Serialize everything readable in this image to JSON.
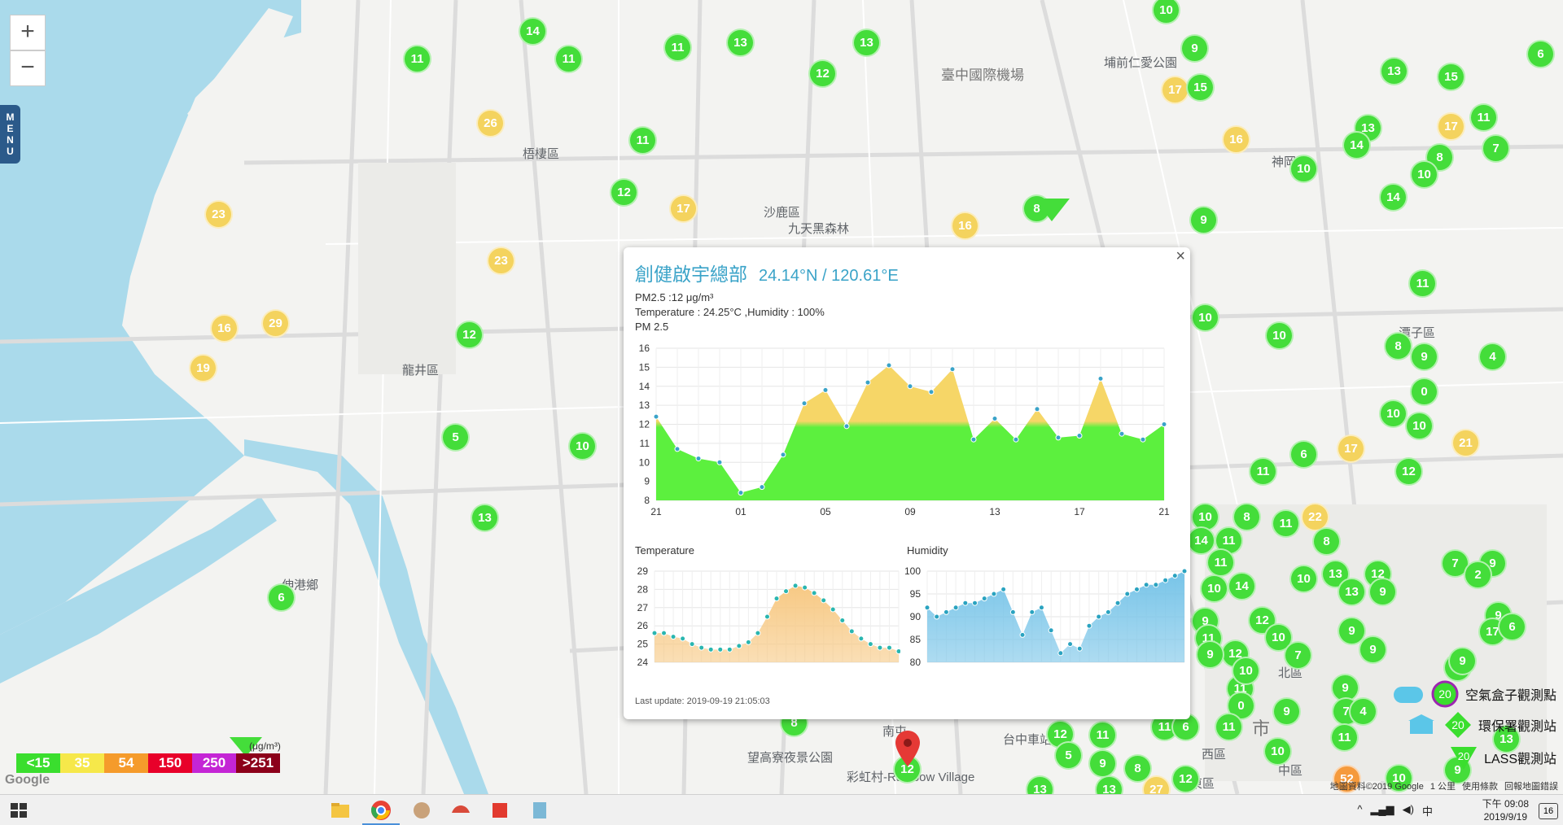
{
  "map": {
    "zoom_in": "+",
    "zoom_out": "−",
    "menu": [
      "M",
      "E",
      "N",
      "U"
    ],
    "labels": {
      "airport": "臺中國際機場",
      "wuqi": "梧棲區",
      "shalu": "沙鹿區",
      "longjing": "龍井區",
      "shengang": "神岡區",
      "tanzi": "潭子區",
      "jiatian": "九天黑森林",
      "park": "埔前仁愛公園",
      "wangao": "望高寮夜景公園",
      "rainbow": "彩虹村-Rainbow Village",
      "north": "北區",
      "west": "西區",
      "east": "東區",
      "central": "中區",
      "city": "市",
      "nanton": "南屯",
      "shengang_x": "伸港鄉",
      "taichung_rw": "台中車站"
    },
    "markers": [
      {
        "n": "10",
        "c": "g",
        "x": 1432,
        "y": 12
      },
      {
        "n": "14",
        "c": "g",
        "x": 654,
        "y": 38
      },
      {
        "n": "11",
        "c": "g",
        "x": 512,
        "y": 72
      },
      {
        "n": "11",
        "c": "g",
        "x": 698,
        "y": 72
      },
      {
        "n": "11",
        "c": "g",
        "x": 832,
        "y": 58
      },
      {
        "n": "13",
        "c": "g",
        "x": 909,
        "y": 52
      },
      {
        "n": "13",
        "c": "g",
        "x": 1064,
        "y": 52
      },
      {
        "n": "12",
        "c": "g",
        "x": 1010,
        "y": 90
      },
      {
        "n": "9",
        "c": "g",
        "x": 1467,
        "y": 59
      },
      {
        "n": "17",
        "c": "y",
        "x": 1443,
        "y": 110
      },
      {
        "n": "15",
        "c": "g",
        "x": 1474,
        "y": 107
      },
      {
        "n": "13",
        "c": "g",
        "x": 1712,
        "y": 87
      },
      {
        "n": "15",
        "c": "g",
        "x": 1782,
        "y": 94
      },
      {
        "n": "6",
        "c": "g",
        "x": 1892,
        "y": 66
      },
      {
        "n": "26",
        "c": "y",
        "x": 602,
        "y": 151
      },
      {
        "n": "11",
        "c": "g",
        "x": 789,
        "y": 172
      },
      {
        "n": "16",
        "c": "y",
        "x": 1518,
        "y": 171
      },
      {
        "n": "13",
        "c": "g",
        "x": 1680,
        "y": 157
      },
      {
        "n": "14",
        "c": "g",
        "x": 1666,
        "y": 178
      },
      {
        "n": "17",
        "c": "y",
        "x": 1782,
        "y": 155
      },
      {
        "n": "11",
        "c": "g",
        "x": 1822,
        "y": 144
      },
      {
        "n": "7",
        "c": "g",
        "x": 1837,
        "y": 182
      },
      {
        "n": "8",
        "c": "g",
        "x": 1768,
        "y": 193
      },
      {
        "n": "10",
        "c": "g",
        "x": 1601,
        "y": 207
      },
      {
        "n": "10",
        "c": "g",
        "x": 1749,
        "y": 214
      },
      {
        "n": "12",
        "c": "g",
        "x": 766,
        "y": 236
      },
      {
        "n": "17",
        "c": "y",
        "x": 839,
        "y": 256
      },
      {
        "n": "8",
        "c": "g",
        "x": 1273,
        "y": 256
      },
      {
        "n": "9",
        "c": "g",
        "x": 1478,
        "y": 270
      },
      {
        "n": "14",
        "c": "g",
        "x": 1711,
        "y": 242
      },
      {
        "n": "23",
        "c": "y",
        "x": 268,
        "y": 263
      },
      {
        "n": "16",
        "c": "y",
        "x": 1185,
        "y": 277
      },
      {
        "n": "23",
        "c": "y",
        "x": 615,
        "y": 320
      },
      {
        "n": "29",
        "c": "y",
        "x": 338,
        "y": 397
      },
      {
        "n": "16",
        "c": "y",
        "x": 275,
        "y": 403
      },
      {
        "n": "19",
        "c": "y",
        "x": 249,
        "y": 452
      },
      {
        "n": "12",
        "c": "g",
        "x": 576,
        "y": 411
      },
      {
        "n": "5",
        "c": "g",
        "x": 559,
        "y": 537
      },
      {
        "n": "10",
        "c": "g",
        "x": 715,
        "y": 548
      },
      {
        "n": "13",
        "c": "g",
        "x": 595,
        "y": 636
      },
      {
        "n": "6",
        "c": "g",
        "x": 345,
        "y": 734
      },
      {
        "n": "10",
        "c": "g",
        "x": 1480,
        "y": 390
      },
      {
        "n": "10",
        "c": "g",
        "x": 1571,
        "y": 412
      },
      {
        "n": "11",
        "c": "g",
        "x": 1747,
        "y": 348
      },
      {
        "n": "8",
        "c": "g",
        "x": 1717,
        "y": 425
      },
      {
        "n": "9",
        "c": "g",
        "x": 1749,
        "y": 438
      },
      {
        "n": "4",
        "c": "g",
        "x": 1833,
        "y": 438
      },
      {
        "n": "0",
        "c": "g",
        "x": 1749,
        "y": 481
      },
      {
        "n": "10",
        "c": "g",
        "x": 1711,
        "y": 508
      },
      {
        "n": "10",
        "c": "g",
        "x": 1743,
        "y": 523
      },
      {
        "n": "21",
        "c": "y",
        "x": 1800,
        "y": 544
      },
      {
        "n": "17",
        "c": "y",
        "x": 1659,
        "y": 551
      },
      {
        "n": "6",
        "c": "g",
        "x": 1601,
        "y": 558
      },
      {
        "n": "11",
        "c": "g",
        "x": 1551,
        "y": 579
      },
      {
        "n": "12",
        "c": "g",
        "x": 1730,
        "y": 579
      },
      {
        "n": "22",
        "c": "y",
        "x": 1615,
        "y": 635
      },
      {
        "n": "10",
        "c": "g",
        "x": 1480,
        "y": 635
      },
      {
        "n": "8",
        "c": "g",
        "x": 1531,
        "y": 635
      },
      {
        "n": "11",
        "c": "g",
        "x": 1579,
        "y": 643
      },
      {
        "n": "8",
        "c": "g",
        "x": 1629,
        "y": 665
      },
      {
        "n": "14",
        "c": "g",
        "x": 1475,
        "y": 664
      },
      {
        "n": "11",
        "c": "g",
        "x": 1509,
        "y": 664
      },
      {
        "n": "11",
        "c": "g",
        "x": 1499,
        "y": 691
      },
      {
        "n": "10",
        "c": "g",
        "x": 1601,
        "y": 711
      },
      {
        "n": "13",
        "c": "g",
        "x": 1640,
        "y": 705
      },
      {
        "n": "12",
        "c": "g",
        "x": 1692,
        "y": 705
      },
      {
        "n": "13",
        "c": "g",
        "x": 1660,
        "y": 727
      },
      {
        "n": "9",
        "c": "g",
        "x": 1698,
        "y": 727
      },
      {
        "n": "10",
        "c": "g",
        "x": 1491,
        "y": 723
      },
      {
        "n": "14",
        "c": "g",
        "x": 1525,
        "y": 720
      },
      {
        "n": "7",
        "c": "g",
        "x": 1787,
        "y": 692
      },
      {
        "n": "9",
        "c": "g",
        "x": 1833,
        "y": 692
      },
      {
        "n": "2",
        "c": "g",
        "x": 1815,
        "y": 706
      },
      {
        "n": "9",
        "c": "g",
        "x": 1840,
        "y": 756
      },
      {
        "n": "17",
        "c": "g",
        "x": 1833,
        "y": 776
      },
      {
        "n": "6",
        "c": "g",
        "x": 1857,
        "y": 770
      },
      {
        "n": "9",
        "c": "g",
        "x": 1480,
        "y": 763
      },
      {
        "n": "11",
        "c": "g",
        "x": 1484,
        "y": 784
      },
      {
        "n": "12",
        "c": "g",
        "x": 1550,
        "y": 762
      },
      {
        "n": "10",
        "c": "g",
        "x": 1570,
        "y": 783
      },
      {
        "n": "9",
        "c": "g",
        "x": 1660,
        "y": 775
      },
      {
        "n": "9",
        "c": "g",
        "x": 1686,
        "y": 798
      },
      {
        "n": "12",
        "c": "g",
        "x": 1517,
        "y": 803
      },
      {
        "n": "9",
        "c": "g",
        "x": 1486,
        "y": 804
      },
      {
        "n": "7",
        "c": "g",
        "x": 1594,
        "y": 805
      },
      {
        "n": "11",
        "c": "g",
        "x": 1523,
        "y": 846
      },
      {
        "n": "10",
        "c": "g",
        "x": 1530,
        "y": 824
      },
      {
        "n": "11",
        "c": "g",
        "x": 1422,
        "y": 811
      },
      {
        "n": "8",
        "c": "g",
        "x": 1790,
        "y": 820
      },
      {
        "n": "9",
        "c": "g",
        "x": 1796,
        "y": 812
      },
      {
        "n": "9",
        "c": "g",
        "x": 1652,
        "y": 845
      },
      {
        "n": "7",
        "c": "g",
        "x": 1653,
        "y": 874
      },
      {
        "n": "4",
        "c": "g",
        "x": 1674,
        "y": 874
      },
      {
        "n": "9",
        "c": "g",
        "x": 1580,
        "y": 874
      },
      {
        "n": "0",
        "c": "g",
        "x": 1524,
        "y": 867
      },
      {
        "n": "11",
        "c": "g",
        "x": 1651,
        "y": 906
      },
      {
        "n": "10",
        "c": "g",
        "x": 1569,
        "y": 923
      },
      {
        "n": "11",
        "c": "g",
        "x": 1430,
        "y": 893
      },
      {
        "n": "12",
        "c": "g",
        "x": 1302,
        "y": 902
      },
      {
        "n": "11",
        "c": "g",
        "x": 1354,
        "y": 903
      },
      {
        "n": "5",
        "c": "g",
        "x": 1312,
        "y": 928
      },
      {
        "n": "9",
        "c": "g",
        "x": 1354,
        "y": 938
      },
      {
        "n": "8",
        "c": "g",
        "x": 1397,
        "y": 944
      },
      {
        "n": "11",
        "c": "g",
        "x": 1509,
        "y": 893
      },
      {
        "n": "6",
        "c": "g",
        "x": 1456,
        "y": 893
      },
      {
        "n": "13",
        "c": "g",
        "x": 1850,
        "y": 908
      },
      {
        "n": "12",
        "c": "g",
        "x": 1456,
        "y": 957
      },
      {
        "n": "9",
        "c": "g",
        "x": 1790,
        "y": 946
      },
      {
        "n": "10",
        "c": "g",
        "x": 1718,
        "y": 956
      },
      {
        "n": "8",
        "c": "g",
        "x": 975,
        "y": 888
      },
      {
        "n": "12",
        "c": "g",
        "x": 1114,
        "y": 945
      },
      {
        "n": "52",
        "c": "o",
        "x": 1654,
        "y": 957
      },
      {
        "n": "13",
        "c": "g",
        "x": 1277,
        "y": 970
      },
      {
        "n": "27",
        "c": "y",
        "x": 1420,
        "y": 970
      },
      {
        "n": "13",
        "c": "g",
        "x": 1362,
        "y": 970
      }
    ]
  },
  "popup": {
    "close": "×",
    "name": "創健啟宇總部",
    "coords": "24.14°N / 120.61°E",
    "pm25_line": "PM2.5 :12 μg/m³",
    "temp_line": "Temperature : 24.25°C ,Humidity : 100%",
    "pm25_chart_title": "PM 2.5",
    "temp_chart_title": "Temperature",
    "hum_chart_title": "Humidity",
    "last_update": "Last update: 2019-09-19 21:05:03"
  },
  "chart_data": [
    {
      "type": "area",
      "title": "PM 2.5",
      "x_ticks": [
        "21",
        "01",
        "05",
        "09",
        "13",
        "17",
        "21"
      ],
      "y_ticks": [
        "8",
        "9",
        "10",
        "11",
        "12",
        "13",
        "14",
        "15",
        "16"
      ],
      "ylim": [
        8,
        16
      ],
      "values": [
        12.4,
        10.7,
        10.2,
        10.0,
        8.4,
        8.7,
        10.4,
        13.1,
        13.8,
        11.9,
        14.2,
        15.1,
        14.0,
        13.7,
        14.9,
        11.2,
        12.3,
        11.2,
        12.8,
        11.3,
        11.4,
        14.4,
        11.5,
        11.2,
        12.0
      ],
      "threshold": 12,
      "colors": {
        "below": "#5cf03e",
        "above": "#f6d667"
      }
    },
    {
      "type": "area",
      "title": "Temperature",
      "y_ticks": [
        "24",
        "25",
        "26",
        "27",
        "28",
        "29"
      ],
      "ylim": [
        24,
        29
      ],
      "values": [
        25.6,
        25.6,
        25.4,
        25.3,
        25.0,
        24.8,
        24.7,
        24.7,
        24.7,
        24.9,
        25.1,
        25.6,
        26.5,
        27.5,
        27.9,
        28.2,
        28.1,
        27.8,
        27.4,
        26.9,
        26.3,
        25.7,
        25.3,
        25.0,
        24.8,
        24.8,
        24.6
      ],
      "colors": {
        "fill": "#f7c984",
        "line": "#2ab6b0"
      }
    },
    {
      "type": "area",
      "title": "Humidity",
      "y_ticks": [
        "80",
        "85",
        "90",
        "95",
        "100"
      ],
      "ylim": [
        80,
        100
      ],
      "values": [
        92,
        90,
        91,
        92,
        93,
        93,
        94,
        95,
        96,
        91,
        86,
        91,
        92,
        87,
        82,
        84,
        83,
        88,
        90,
        91,
        93,
        95,
        96,
        97,
        97,
        98,
        99,
        100
      ],
      "colors": {
        "fill": "#77c4e8",
        "line": "#2aa3c0"
      }
    }
  ],
  "legend": {
    "units": "(μg/m³)",
    "items": [
      {
        "label": "<15",
        "color": "#3ade2e"
      },
      {
        "label": "35",
        "color": "#f6e84a"
      },
      {
        "label": "54",
        "color": "#f59b2b"
      },
      {
        "label": "150",
        "color": "#e8002a"
      },
      {
        "label": "250",
        "color": "#c425d5"
      },
      {
        "label": ">251",
        "color": "#8c001a"
      }
    ]
  },
  "stations": [
    {
      "value": "20",
      "label": "空氣盒子觀測點"
    },
    {
      "value": "20",
      "label": "環保署觀測站"
    },
    {
      "value": "20",
      "label": "LASS觀測站"
    }
  ],
  "attribution": {
    "google": "Google",
    "mapdata": "地圖資料©2019 Google",
    "scale": "1 公里",
    "terms": "使用條款",
    "report": "回報地圖錯誤"
  },
  "taskbar": {
    "tray_ime": "中",
    "time": "下午 09:08",
    "date": "2019/9/19",
    "notifications": "16"
  }
}
